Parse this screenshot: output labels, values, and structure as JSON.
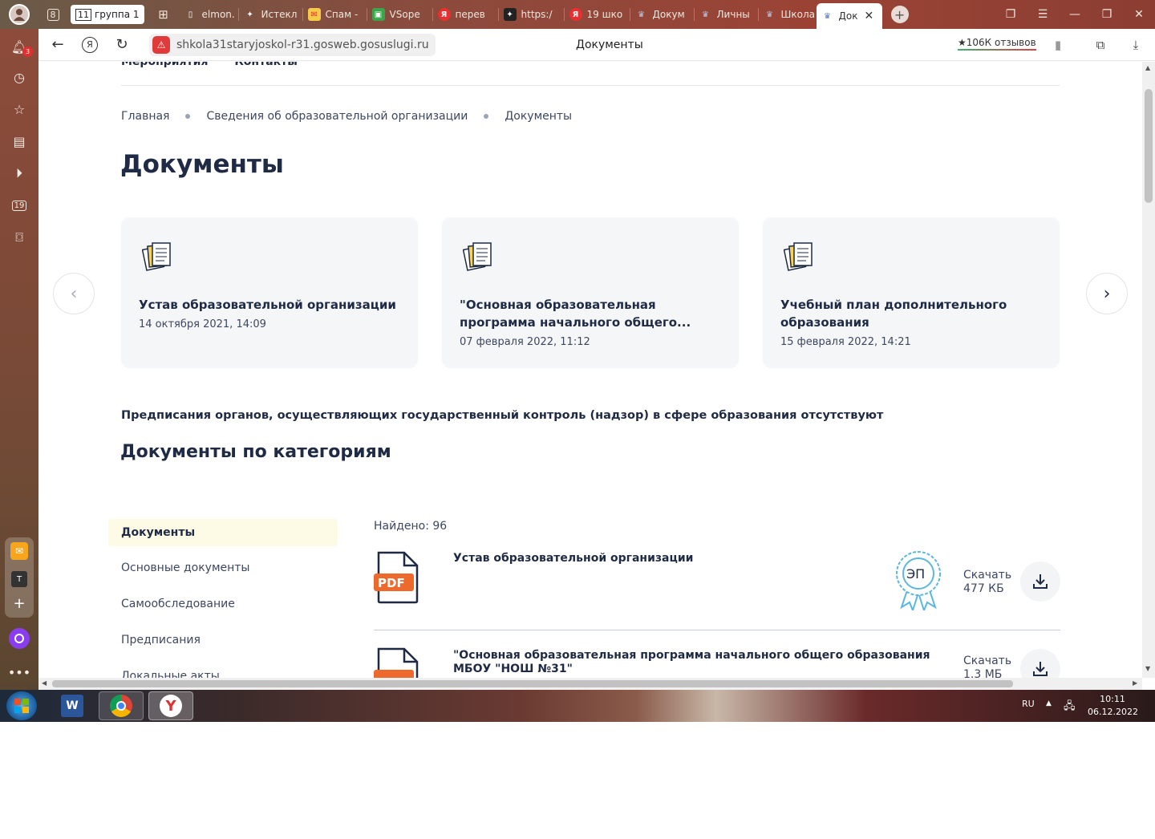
{
  "browser": {
    "tab_count_badge": "8",
    "group": {
      "count": "11",
      "label": "группа 1"
    },
    "tabs": [
      {
        "label": "elmon.",
        "icon": "doc-icon"
      },
      {
        "label": "Истекл",
        "icon": "sparkle-icon"
      },
      {
        "label": "Спам -",
        "icon": "mail-icon"
      },
      {
        "label": "VSope",
        "icon": "vsop-icon"
      },
      {
        "label": "перев",
        "icon": "yandex-icon"
      },
      {
        "label": "https:/",
        "icon": "star-icon"
      },
      {
        "label": "19 шко",
        "icon": "yandex-icon"
      },
      {
        "label": "Докум",
        "icon": "emblem-icon"
      },
      {
        "label": "Личны",
        "icon": "emblem-icon"
      },
      {
        "label": "Школа",
        "icon": "emblem-icon"
      }
    ],
    "active_tab": {
      "label": "Док",
      "icon": "emblem-icon"
    },
    "notif_badge": "3",
    "calendar_day": "19",
    "url": "shkola31staryjoskol-r31.gosweb.gosuslugi.ru",
    "page_title": "Документы",
    "reviews": "★106К отзывов"
  },
  "page": {
    "topnav": [
      "Мероприятия",
      "Контакты"
    ],
    "breadcrumbs": [
      "Главная",
      "Сведения об образовательной организации",
      "Документы"
    ],
    "title": "Документы",
    "cards": [
      {
        "title": "Устав образовательной организации",
        "date": "14 октября 2021, 14:09"
      },
      {
        "title": "\"Основная образовательная программа начального общего...",
        "date": "07 февраля 2022, 11:12"
      },
      {
        "title": "Учебный план дополнительного образования",
        "date": "15 февраля 2022, 14:21"
      }
    ],
    "notice": "Предписания органов, осуществляющих государственный контроль (надзор) в сфере образования отсутствуют",
    "categories_title": "Документы по категориям",
    "categories": [
      "Документы",
      "Основные документы",
      "Самообследование",
      "Предписания",
      "Локальные акты"
    ],
    "found": "Найдено: 96",
    "documents": [
      {
        "title": "Устав образовательной организации",
        "badge": "PDF",
        "seal": "ЭП",
        "download": "Скачать",
        "size": "477 КБ"
      },
      {
        "title": "\"Основная образовательная программа начального общего образования МБОУ \"НОШ №31\"",
        "badge": "PDF",
        "download": "Скачать",
        "size": "1.3 МБ"
      }
    ]
  },
  "taskbar": {
    "lang": "RU",
    "time": "10:11",
    "date": "06.12.2022"
  },
  "colors": {
    "accent_orange": "#ee6a2c",
    "seal_blue": "#5bb8dc",
    "text_dark": "#1f2a44"
  }
}
